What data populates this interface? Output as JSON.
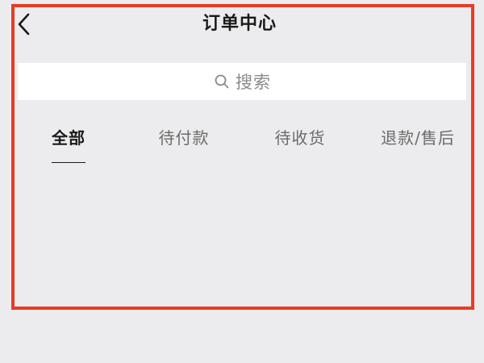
{
  "header": {
    "title": "订单中心",
    "back_icon": "chevron-left-icon"
  },
  "search": {
    "placeholder": "搜索",
    "icon": "search-icon"
  },
  "tabs": [
    {
      "label": "全部",
      "active": true
    },
    {
      "label": "待付款",
      "active": false
    },
    {
      "label": "待收货",
      "active": false
    },
    {
      "label": "退款/售后",
      "active": false
    }
  ],
  "colors": {
    "background": "#ecebed",
    "highlight_frame": "#e83b25",
    "active_tab": "#1a1a1a",
    "inactive_tab": "#6b6b6b"
  }
}
